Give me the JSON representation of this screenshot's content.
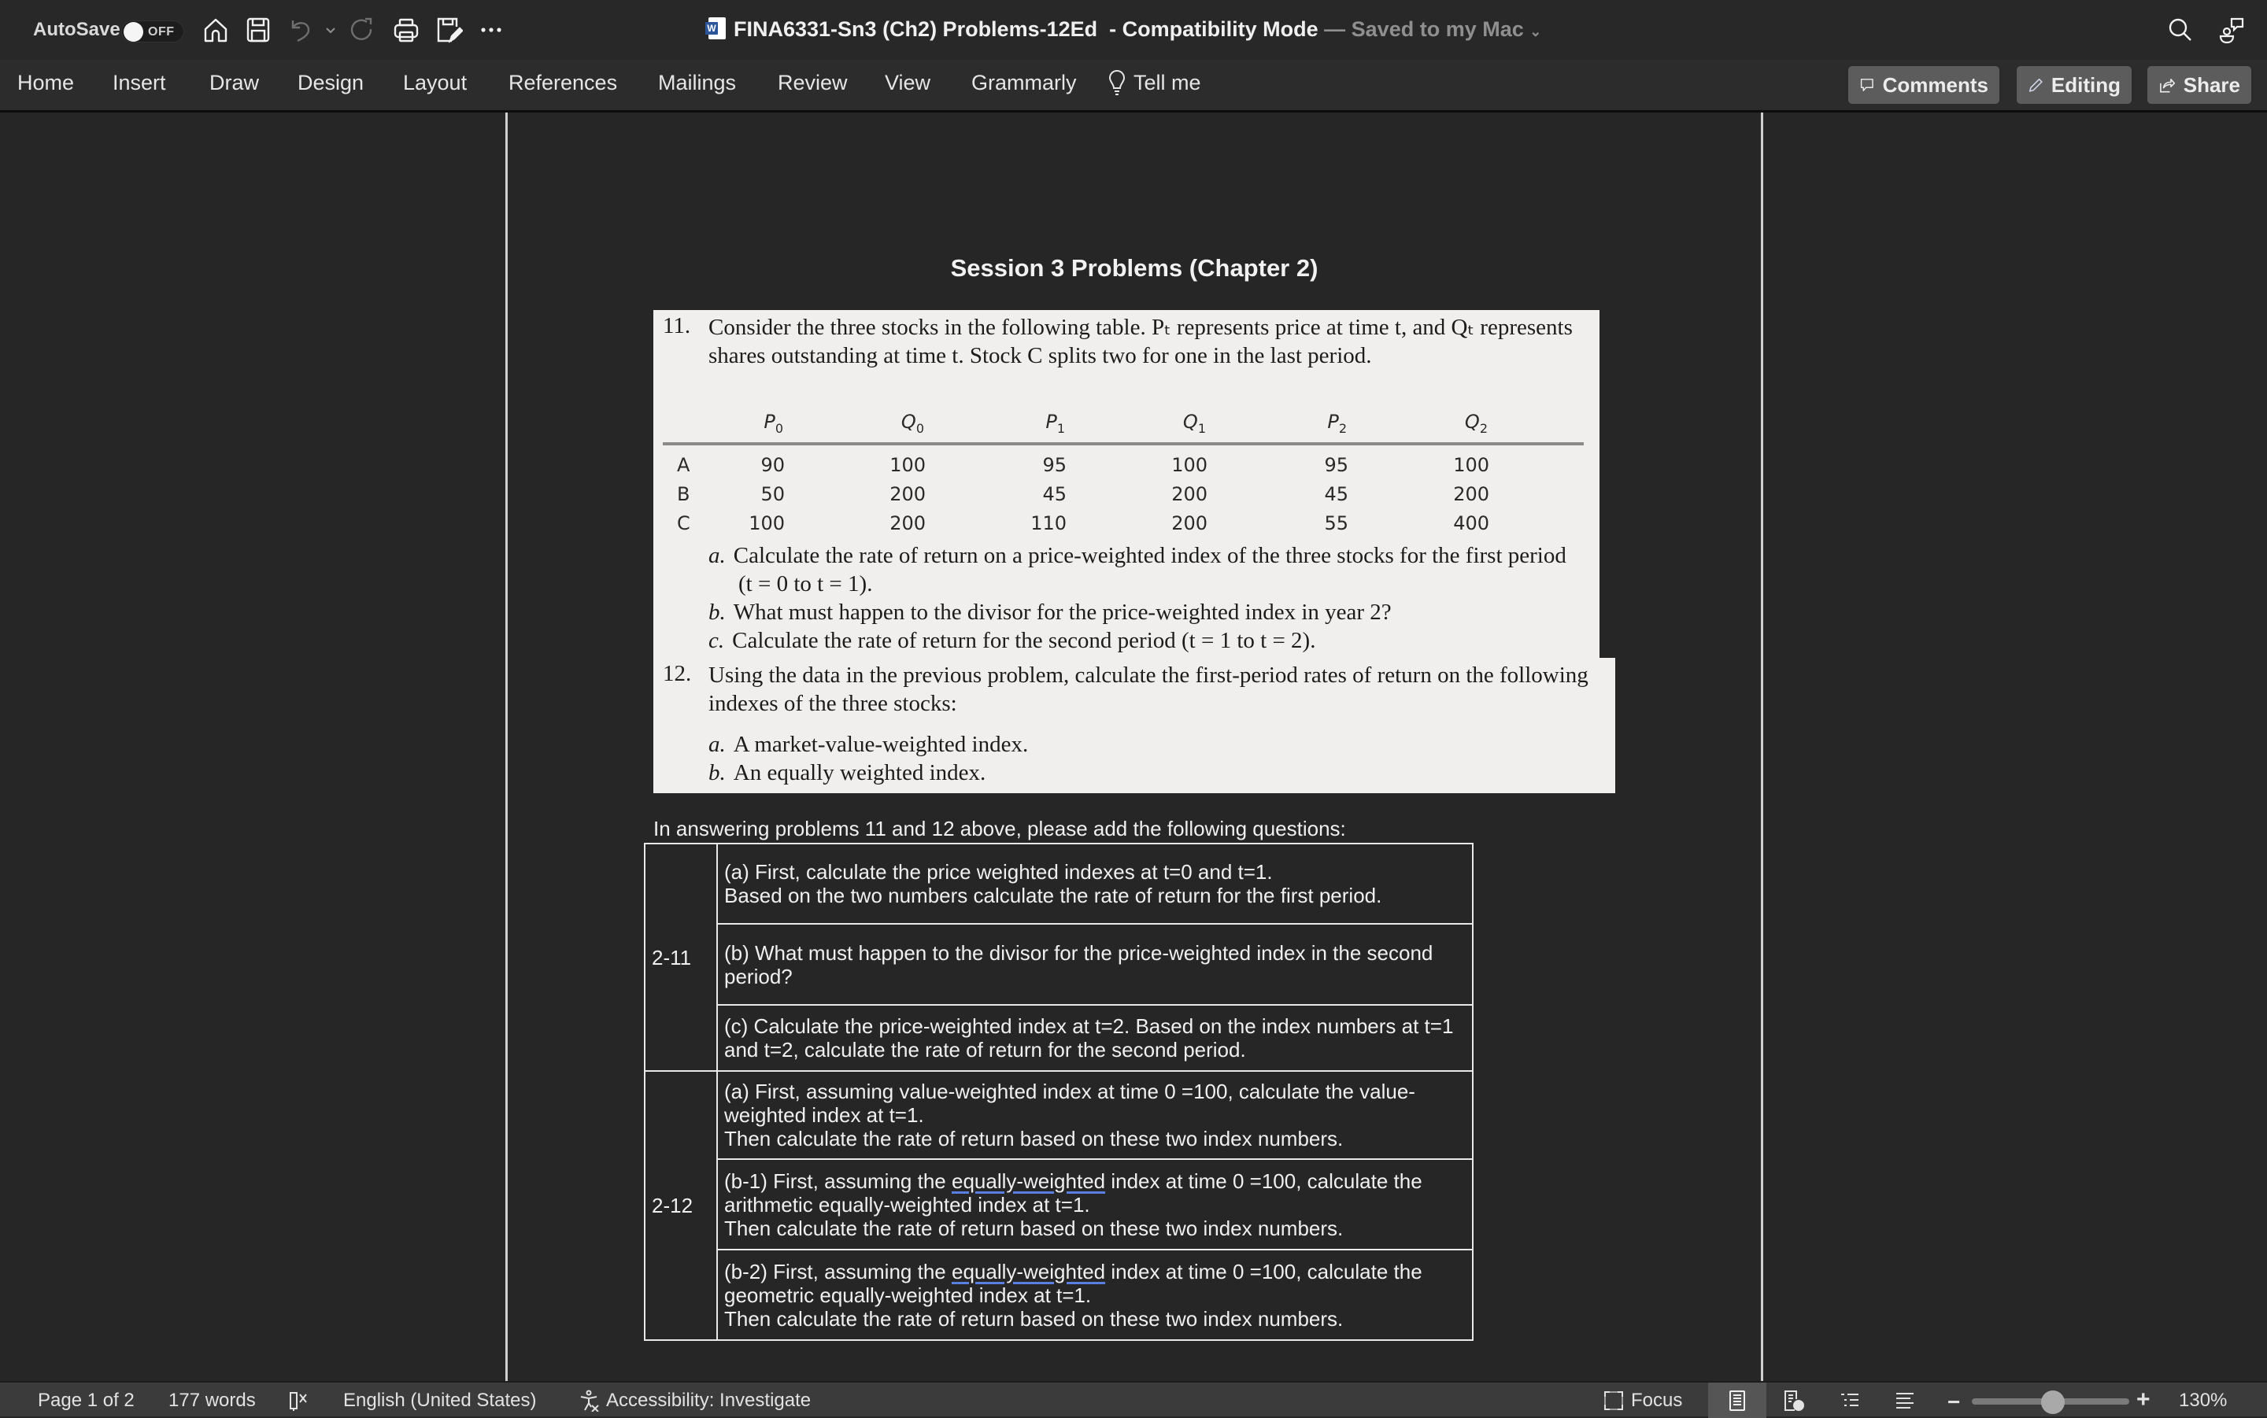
{
  "titlebar": {
    "autosave_label": "AutoSave",
    "autosave_state": "OFF",
    "doc_name": "FINA6331-Sn3 (Ch2) Problems-12Ed",
    "mode": "-  Compatibility Mode",
    "saved_status": "— Saved to my Mac",
    "icons": [
      "home-icon",
      "save-icon",
      "undo-icon",
      "undo-dropdown-icon",
      "redo-icon",
      "print-icon",
      "save-as-icon",
      "more-icon",
      "search-icon",
      "coauthor-icon"
    ]
  },
  "ribbon": {
    "tabs": [
      "Home",
      "Insert",
      "Draw",
      "Design",
      "Layout",
      "References",
      "Mailings",
      "Review",
      "View",
      "Grammarly"
    ],
    "tell_me": "Tell me",
    "comments_label": "Comments",
    "editing_label": "Editing",
    "share_label": "Share"
  },
  "document": {
    "heading": "Session 3 Problems (Chapter 2)",
    "problem11": {
      "number": "11.",
      "text_line1": "Consider the three stocks in the following table. Pₜ represents price at time t, and Qₜ represents",
      "text_line2": "shares outstanding at time t. Stock C splits two for one in the last period.",
      "table": {
        "columns": [
          "",
          "P0",
          "Q0",
          "P1",
          "Q1",
          "P2",
          "Q2"
        ],
        "column_letters": [
          "P",
          "Q",
          "P",
          "Q",
          "P",
          "Q"
        ],
        "column_subs": [
          "0",
          "0",
          "1",
          "1",
          "2",
          "2"
        ],
        "rows": [
          {
            "stock": "A",
            "values": [
              "90",
              "100",
              "95",
              "100",
              "95",
              "100"
            ]
          },
          {
            "stock": "B",
            "values": [
              "50",
              "200",
              "45",
              "200",
              "45",
              "200"
            ]
          },
          {
            "stock": "C",
            "values": [
              "100",
              "200",
              "110",
              "200",
              "55",
              "400"
            ]
          }
        ]
      },
      "parts": [
        {
          "letter": "a.",
          "text": "Calculate the rate of return on a price-weighted index of the three stocks for the first period",
          "cont": "(t = 0 to t = 1)."
        },
        {
          "letter": "b.",
          "text": "What must happen to the divisor for the price-weighted index in year 2?"
        },
        {
          "letter": "c.",
          "text": "Calculate the rate of return for the second period (t = 1 to t = 2)."
        }
      ]
    },
    "problem12": {
      "number": "12.",
      "text_line1": "Using the data in the previous problem, calculate the first-period rates of return on the following",
      "text_line2": "indexes of the three stocks:",
      "parts": [
        {
          "letter": "a.",
          "text": "A market-value-weighted index."
        },
        {
          "letter": "b.",
          "text": "An equally weighted index."
        }
      ]
    },
    "intro": "In answering problems 11 and 12 above, please add the following questions:",
    "questions": [
      {
        "group": "2-11",
        "items": [
          {
            "lines": [
              "(a) First, calculate the price weighted indexes at t=0 and t=1.",
              "Based on the two numbers calculate the rate of return for the first period."
            ]
          },
          {
            "lines": [
              "(b) What must happen to the divisor for the price-weighted index in the second",
              "period?"
            ]
          },
          {
            "lines": [
              "(c) Calculate the price-weighted index at t=2. Based on the index numbers at t=1",
              "and t=2, calculate the rate of return for the second period."
            ]
          }
        ]
      },
      {
        "group": "2-12",
        "items": [
          {
            "lines": [
              "(a) First, assuming value-weighted index at time 0 =100, calculate the value-",
              "weighted index at t=1.",
              "Then calculate the rate of return based on these two index numbers."
            ]
          },
          {
            "pre": "(b-1) First, assuming the ",
            "flagged": "equally-weighted",
            "post": " index at time 0 =100, calculate the",
            "lines": [
              "arithmetic equally-weighted index at t=1.",
              "Then calculate the rate of return based on these two index numbers."
            ]
          },
          {
            "pre": "(b-2) First, assuming the ",
            "flagged": "equally-weighted",
            "post": " index at time 0 =100, calculate the",
            "lines": [
              "geometric equally-weighted index at t=1.",
              "Then calculate the rate of return based on these two index numbers."
            ]
          }
        ]
      }
    ]
  },
  "statusbar": {
    "page": "Page 1 of 2",
    "words": "177 words",
    "language": "English (United States)",
    "accessibility": "Accessibility: Investigate",
    "focus": "Focus",
    "zoom": "130%",
    "zoom_percent": 130
  }
}
